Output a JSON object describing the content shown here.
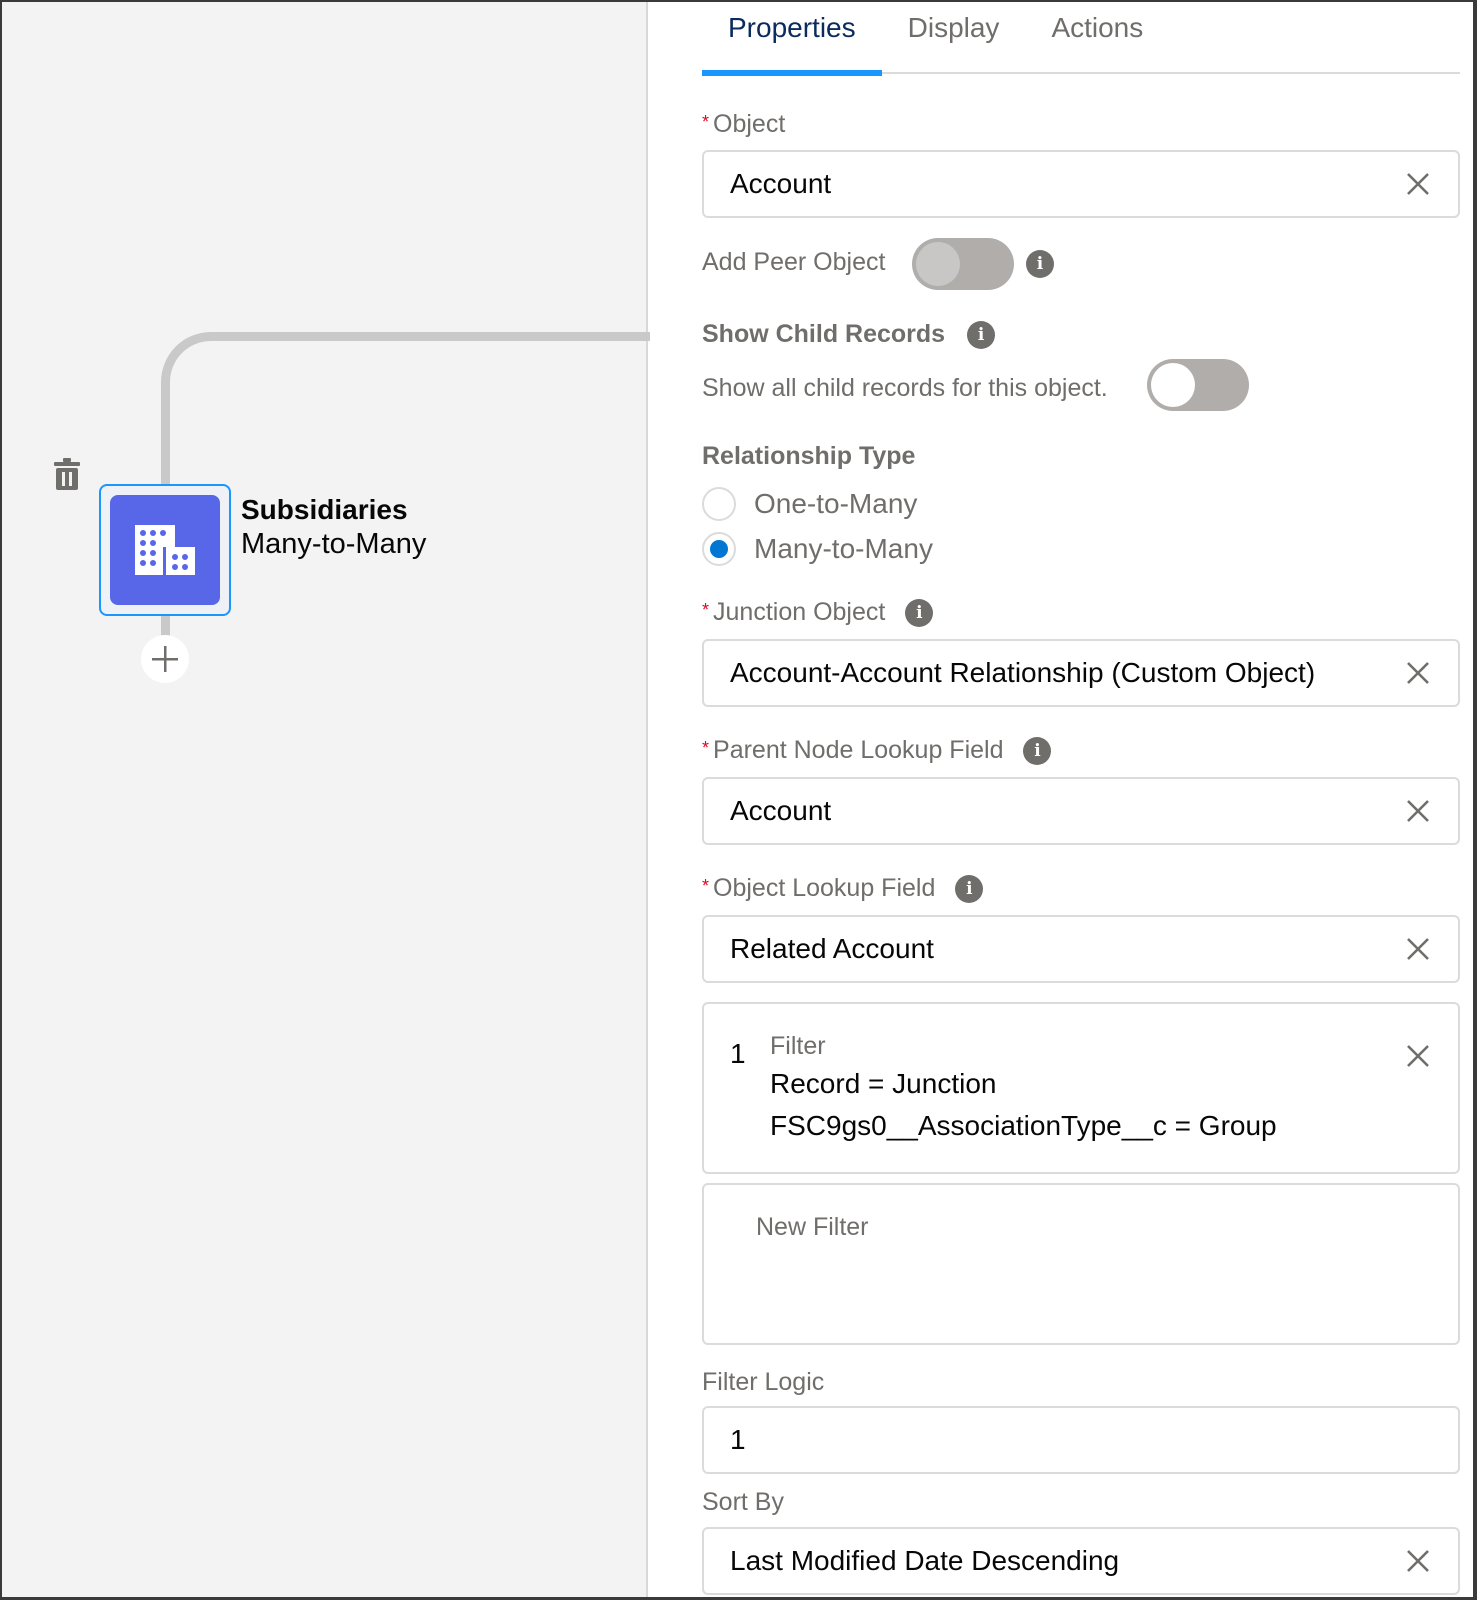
{
  "canvas": {
    "node": {
      "title": "Subsidiaries",
      "subtitle": "Many-to-Many",
      "icon": "building-icon",
      "icon_color": "#5867e8",
      "selected_border_color": "#1b96ff"
    },
    "delete_icon": "trash-icon",
    "add_icon": "plus-icon"
  },
  "panel": {
    "tabs": [
      {
        "label": "Properties",
        "active": true
      },
      {
        "label": "Display",
        "active": false
      },
      {
        "label": "Actions",
        "active": false
      }
    ],
    "object": {
      "label": "Object",
      "required": true,
      "value": "Account"
    },
    "add_peer_object": {
      "label": "Add Peer Object",
      "state": "off-disabled"
    },
    "show_child_records": {
      "heading": "Show Child Records",
      "help": "Show all child records for this object.",
      "state": "off"
    },
    "relationship_type": {
      "heading": "Relationship Type",
      "options": [
        {
          "label": "One-to-Many",
          "selected": false
        },
        {
          "label": "Many-to-Many",
          "selected": true
        }
      ]
    },
    "junction_object": {
      "label": "Junction Object",
      "required": true,
      "value": "Account-Account Relationship (Custom Object)"
    },
    "parent_node_lookup_field": {
      "label": "Parent Node Lookup Field",
      "required": true,
      "value": "Account"
    },
    "object_lookup_field": {
      "label": "Object Lookup Field",
      "required": true,
      "value": "Related Account"
    },
    "filters": [
      {
        "number": "1",
        "heading": "Filter",
        "conditions": [
          "Record = Junction",
          "FSC9gs0__AssociationType__c = Group"
        ]
      }
    ],
    "new_filter_label": "New Filter",
    "filter_logic": {
      "label": "Filter Logic",
      "value": "1"
    },
    "sort_by": {
      "label": "Sort By",
      "value": "Last Modified Date Descending"
    },
    "required_marker": "*",
    "info_glyph": "i",
    "accent_color": "#1b96ff",
    "radio_selected_color": "#0176d3",
    "required_color": "#ea001e"
  }
}
